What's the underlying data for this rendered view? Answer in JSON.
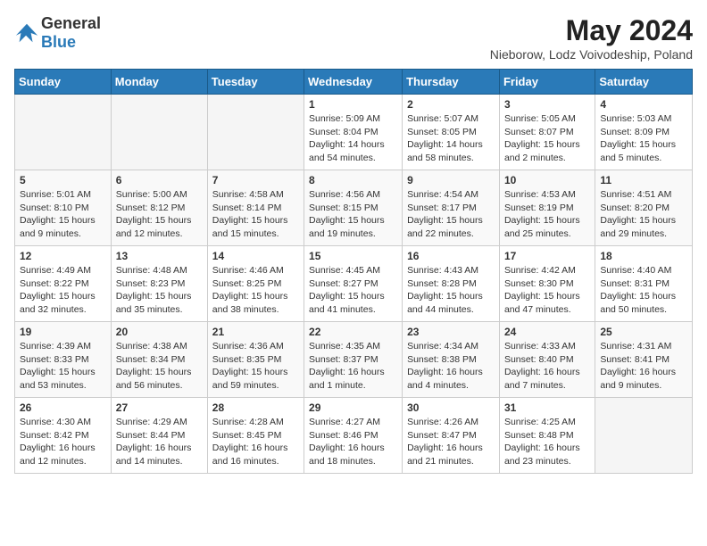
{
  "header": {
    "logo_general": "General",
    "logo_blue": "Blue",
    "month_title": "May 2024",
    "location": "Nieborow, Lodz Voivodeship, Poland"
  },
  "days_of_week": [
    "Sunday",
    "Monday",
    "Tuesday",
    "Wednesday",
    "Thursday",
    "Friday",
    "Saturday"
  ],
  "weeks": [
    [
      {
        "day": "",
        "info": ""
      },
      {
        "day": "",
        "info": ""
      },
      {
        "day": "",
        "info": ""
      },
      {
        "day": "1",
        "info": "Sunrise: 5:09 AM\nSunset: 8:04 PM\nDaylight: 14 hours\nand 54 minutes."
      },
      {
        "day": "2",
        "info": "Sunrise: 5:07 AM\nSunset: 8:05 PM\nDaylight: 14 hours\nand 58 minutes."
      },
      {
        "day": "3",
        "info": "Sunrise: 5:05 AM\nSunset: 8:07 PM\nDaylight: 15 hours\nand 2 minutes."
      },
      {
        "day": "4",
        "info": "Sunrise: 5:03 AM\nSunset: 8:09 PM\nDaylight: 15 hours\nand 5 minutes."
      }
    ],
    [
      {
        "day": "5",
        "info": "Sunrise: 5:01 AM\nSunset: 8:10 PM\nDaylight: 15 hours\nand 9 minutes."
      },
      {
        "day": "6",
        "info": "Sunrise: 5:00 AM\nSunset: 8:12 PM\nDaylight: 15 hours\nand 12 minutes."
      },
      {
        "day": "7",
        "info": "Sunrise: 4:58 AM\nSunset: 8:14 PM\nDaylight: 15 hours\nand 15 minutes."
      },
      {
        "day": "8",
        "info": "Sunrise: 4:56 AM\nSunset: 8:15 PM\nDaylight: 15 hours\nand 19 minutes."
      },
      {
        "day": "9",
        "info": "Sunrise: 4:54 AM\nSunset: 8:17 PM\nDaylight: 15 hours\nand 22 minutes."
      },
      {
        "day": "10",
        "info": "Sunrise: 4:53 AM\nSunset: 8:19 PM\nDaylight: 15 hours\nand 25 minutes."
      },
      {
        "day": "11",
        "info": "Sunrise: 4:51 AM\nSunset: 8:20 PM\nDaylight: 15 hours\nand 29 minutes."
      }
    ],
    [
      {
        "day": "12",
        "info": "Sunrise: 4:49 AM\nSunset: 8:22 PM\nDaylight: 15 hours\nand 32 minutes."
      },
      {
        "day": "13",
        "info": "Sunrise: 4:48 AM\nSunset: 8:23 PM\nDaylight: 15 hours\nand 35 minutes."
      },
      {
        "day": "14",
        "info": "Sunrise: 4:46 AM\nSunset: 8:25 PM\nDaylight: 15 hours\nand 38 minutes."
      },
      {
        "day": "15",
        "info": "Sunrise: 4:45 AM\nSunset: 8:27 PM\nDaylight: 15 hours\nand 41 minutes."
      },
      {
        "day": "16",
        "info": "Sunrise: 4:43 AM\nSunset: 8:28 PM\nDaylight: 15 hours\nand 44 minutes."
      },
      {
        "day": "17",
        "info": "Sunrise: 4:42 AM\nSunset: 8:30 PM\nDaylight: 15 hours\nand 47 minutes."
      },
      {
        "day": "18",
        "info": "Sunrise: 4:40 AM\nSunset: 8:31 PM\nDaylight: 15 hours\nand 50 minutes."
      }
    ],
    [
      {
        "day": "19",
        "info": "Sunrise: 4:39 AM\nSunset: 8:33 PM\nDaylight: 15 hours\nand 53 minutes."
      },
      {
        "day": "20",
        "info": "Sunrise: 4:38 AM\nSunset: 8:34 PM\nDaylight: 15 hours\nand 56 minutes."
      },
      {
        "day": "21",
        "info": "Sunrise: 4:36 AM\nSunset: 8:35 PM\nDaylight: 15 hours\nand 59 minutes."
      },
      {
        "day": "22",
        "info": "Sunrise: 4:35 AM\nSunset: 8:37 PM\nDaylight: 16 hours\nand 1 minute."
      },
      {
        "day": "23",
        "info": "Sunrise: 4:34 AM\nSunset: 8:38 PM\nDaylight: 16 hours\nand 4 minutes."
      },
      {
        "day": "24",
        "info": "Sunrise: 4:33 AM\nSunset: 8:40 PM\nDaylight: 16 hours\nand 7 minutes."
      },
      {
        "day": "25",
        "info": "Sunrise: 4:31 AM\nSunset: 8:41 PM\nDaylight: 16 hours\nand 9 minutes."
      }
    ],
    [
      {
        "day": "26",
        "info": "Sunrise: 4:30 AM\nSunset: 8:42 PM\nDaylight: 16 hours\nand 12 minutes."
      },
      {
        "day": "27",
        "info": "Sunrise: 4:29 AM\nSunset: 8:44 PM\nDaylight: 16 hours\nand 14 minutes."
      },
      {
        "day": "28",
        "info": "Sunrise: 4:28 AM\nSunset: 8:45 PM\nDaylight: 16 hours\nand 16 minutes."
      },
      {
        "day": "29",
        "info": "Sunrise: 4:27 AM\nSunset: 8:46 PM\nDaylight: 16 hours\nand 18 minutes."
      },
      {
        "day": "30",
        "info": "Sunrise: 4:26 AM\nSunset: 8:47 PM\nDaylight: 16 hours\nand 21 minutes."
      },
      {
        "day": "31",
        "info": "Sunrise: 4:25 AM\nSunset: 8:48 PM\nDaylight: 16 hours\nand 23 minutes."
      },
      {
        "day": "",
        "info": ""
      }
    ]
  ]
}
